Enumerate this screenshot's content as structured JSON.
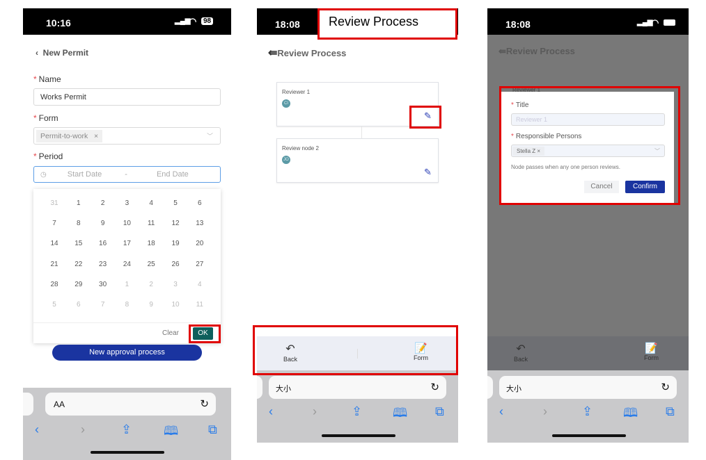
{
  "phone1": {
    "time": "10:16",
    "battery": "98",
    "back_title": "New Permit",
    "name_label": "Name",
    "name_value": "Works Permit",
    "form_label": "Form",
    "form_tag": "Permit-to-work",
    "period_label": "Period",
    "start_placeholder": "Start Date",
    "separator": "-",
    "end_placeholder": "End Date",
    "calendar": [
      [
        "31",
        "1",
        "2",
        "3",
        "4",
        "5",
        "6"
      ],
      [
        "7",
        "8",
        "9",
        "10",
        "11",
        "12",
        "13"
      ],
      [
        "14",
        "15",
        "16",
        "17",
        "18",
        "19",
        "20"
      ],
      [
        "21",
        "22",
        "23",
        "24",
        "25",
        "26",
        "27"
      ],
      [
        "28",
        "29",
        "30",
        "1",
        "2",
        "3",
        "4"
      ],
      [
        "5",
        "6",
        "7",
        "8",
        "9",
        "10",
        "11"
      ]
    ],
    "clear_label": "Clear",
    "ok_label": "OK",
    "primary_button": "New approval process",
    "addr_text": "AA",
    "ok_color": "#0e5f5c",
    "primary_color": "#1a34a0"
  },
  "phone2": {
    "time": "18:08",
    "annotation": "Review Process",
    "title": "Review Process",
    "nodes": [
      {
        "title": "Reviewer 1",
        "avatar": "CI"
      },
      {
        "title": "Review node 2",
        "avatar": "JO"
      }
    ],
    "back_label": "Back",
    "form_label": "Form",
    "addr_text": "大小"
  },
  "phone3": {
    "time": "18:08",
    "title": "Review Process",
    "bg_node": "Reviewer 1",
    "modal": {
      "title_label": "Title",
      "title_placeholder": "Reviewer 1",
      "persons_label": "Responsible Persons",
      "person_tag": "Stella Z",
      "note": "Node passes when any one person reviews.",
      "cancel": "Cancel",
      "confirm": "Confirm"
    },
    "back_label": "Back",
    "form_label": "Form",
    "addr_text": "大小"
  }
}
